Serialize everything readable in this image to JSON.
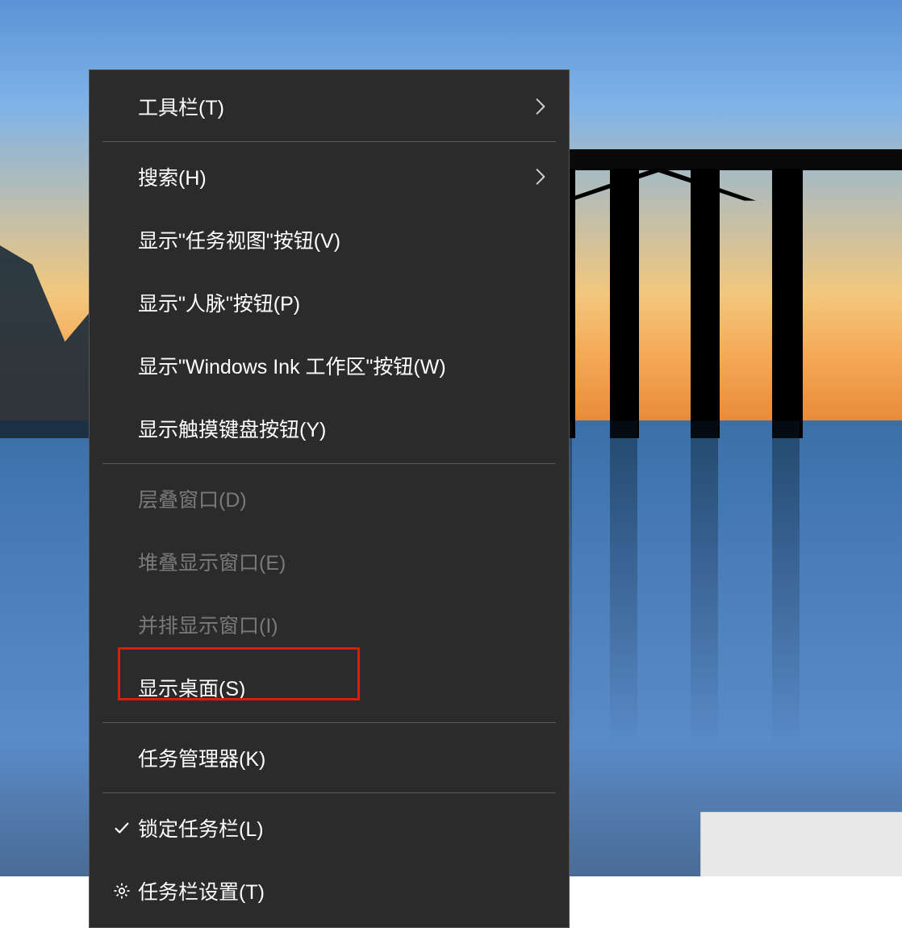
{
  "menu": {
    "groups": [
      [
        {
          "id": "toolbars",
          "label": "工具栏(T)",
          "submenu": true,
          "disabled": false,
          "icon": null
        }
      ],
      [
        {
          "id": "search",
          "label": "搜索(H)",
          "submenu": true,
          "disabled": false,
          "icon": null
        },
        {
          "id": "show-task-view",
          "label": "显示\"任务视图\"按钮(V)",
          "submenu": false,
          "disabled": false,
          "icon": null
        },
        {
          "id": "show-people",
          "label": "显示\"人脉\"按钮(P)",
          "submenu": false,
          "disabled": false,
          "icon": null
        },
        {
          "id": "show-ink",
          "label": "显示\"Windows Ink 工作区\"按钮(W)",
          "submenu": false,
          "disabled": false,
          "icon": null
        },
        {
          "id": "show-touch-keyboard",
          "label": "显示触摸键盘按钮(Y)",
          "submenu": false,
          "disabled": false,
          "icon": null
        }
      ],
      [
        {
          "id": "cascade",
          "label": "层叠窗口(D)",
          "submenu": false,
          "disabled": true,
          "icon": null
        },
        {
          "id": "stacked",
          "label": "堆叠显示窗口(E)",
          "submenu": false,
          "disabled": true,
          "icon": null
        },
        {
          "id": "sidebyside",
          "label": "并排显示窗口(I)",
          "submenu": false,
          "disabled": true,
          "icon": null
        },
        {
          "id": "show-desktop",
          "label": "显示桌面(S)",
          "submenu": false,
          "disabled": false,
          "icon": null
        }
      ],
      [
        {
          "id": "task-manager",
          "label": "任务管理器(K)",
          "submenu": false,
          "disabled": false,
          "icon": null,
          "highlighted": true
        }
      ],
      [
        {
          "id": "lock-taskbar",
          "label": "锁定任务栏(L)",
          "submenu": false,
          "disabled": false,
          "icon": "check"
        },
        {
          "id": "taskbar-settings",
          "label": "任务栏设置(T)",
          "submenu": false,
          "disabled": false,
          "icon": "gear"
        }
      ]
    ]
  },
  "colors": {
    "menu_bg": "#2b2b2b",
    "menu_text": "#ffffff",
    "disabled_text": "#7a7a7a",
    "highlight_border": "#d81e06"
  }
}
